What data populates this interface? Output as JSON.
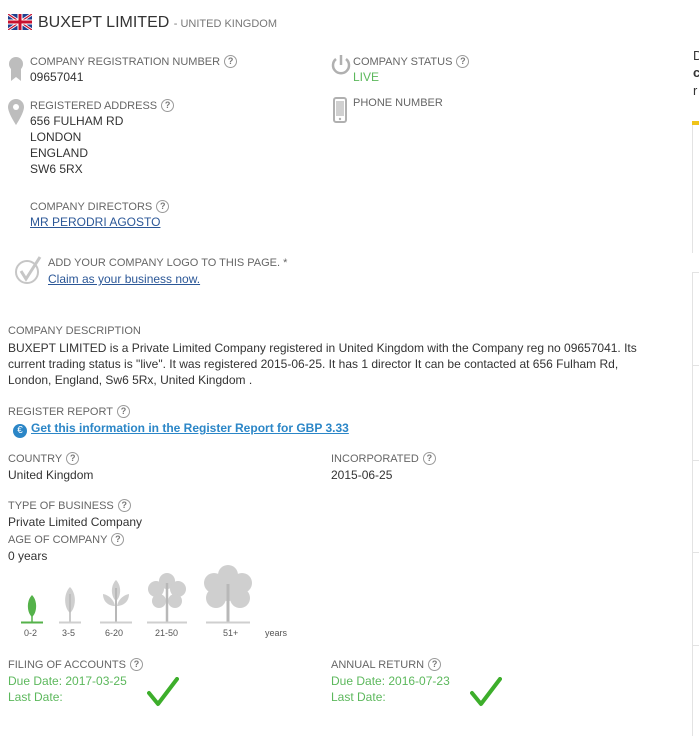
{
  "header": {
    "company_name": "BUXEPT LIMITED",
    "country_suffix": "- UNITED KINGDOM"
  },
  "registration": {
    "label": "COMPANY REGISTRATION NUMBER",
    "value": "09657041"
  },
  "status": {
    "label": "COMPANY STATUS",
    "value": "LIVE"
  },
  "address": {
    "label": "REGISTERED ADDRESS",
    "lines": [
      "656 FULHAM RD",
      "LONDON",
      "ENGLAND",
      "SW6 5RX"
    ]
  },
  "phone": {
    "label": "PHONE NUMBER"
  },
  "directors": {
    "label": "COMPANY DIRECTORS",
    "names": [
      "MR PERODRI AGOSTO"
    ]
  },
  "logo": {
    "text": "ADD YOUR COMPANY LOGO TO THIS PAGE. *",
    "claim_link": "Claim as your business now."
  },
  "description": {
    "label": "COMPANY DESCRIPTION",
    "text": "BUXEPT LIMITED is a Private Limited Company registered in United Kingdom with the Company reg no 09657041. Its current trading status is \"live\". It was registered 2015-06-25. It has 1 director It can be contacted at 656 Fulham Rd, London, England, Sw6 5Rx, United Kingdom ."
  },
  "register_report": {
    "label": "REGISTER REPORT",
    "link": "Get this information in the Register Report for GBP 3.33"
  },
  "country": {
    "label": "COUNTRY",
    "value": "United Kingdom"
  },
  "incorporated": {
    "label": "INCORPORATED",
    "value": "2015-06-25"
  },
  "business_type": {
    "label": "TYPE OF BUSINESS",
    "value": "Private Limited Company"
  },
  "age": {
    "label": "AGE OF COMPANY",
    "value": "0 years",
    "scale": [
      "0-2",
      "3-5",
      "6-20",
      "21-50",
      "51+"
    ],
    "unit": "years",
    "active_index": 0
  },
  "filing": {
    "label": "FILING OF ACCOUNTS",
    "due": "Due Date: 2017-03-25",
    "last": "Last Date:"
  },
  "annual_return": {
    "label": "ANNUAL RETURN",
    "due": "Due Date: 2016-07-23",
    "last": "Last Date:"
  },
  "sidebar": {
    "frag1": "D",
    "frag2": "c",
    "frag3": "r"
  },
  "help_glyph": "?",
  "euro_glyph": "€",
  "colors": {
    "green": "#5cb85c",
    "link": "#2b5797",
    "accent_yellow": "#f0c419"
  }
}
